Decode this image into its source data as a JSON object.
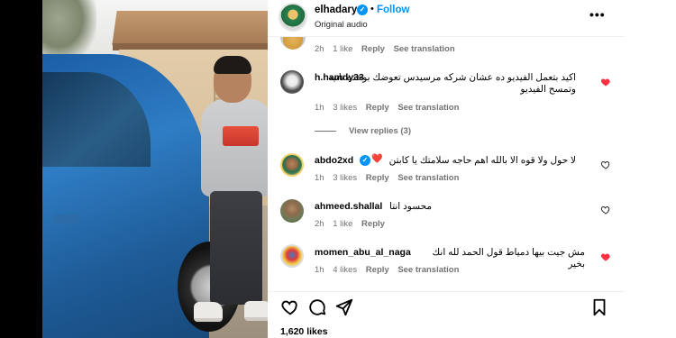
{
  "post": {
    "owner": "elhadary",
    "follow_label": "Follow",
    "separator": "•",
    "audio_label": "Original audio",
    "more_label": "•••",
    "likes_label": "1,620 likes"
  },
  "comments": {
    "first_meta": {
      "time": "2h",
      "likes": "1 like",
      "reply": "Reply",
      "translate": "See translation"
    },
    "items": [
      {
        "username": "h.hamdy33",
        "text": "اكيد بتعمل الفيديو ده عشان شركه مرسيدس تعوضك بوحده تانيه وتمسح الفيديو",
        "time": "1h",
        "likes": "3 likes",
        "reply": "Reply",
        "translate": "See translation",
        "liked": true
      },
      {
        "username": "abdo2xd",
        "text": "لا حول ولا قوه الا بالله اهم حاجه سلامتك يا كابتن",
        "emoji": "❤️",
        "time": "1h",
        "likes": "3 likes",
        "reply": "Reply",
        "translate": "See translation",
        "liked": false
      },
      {
        "username": "ahmeed.shallal",
        "text": "محسود انتا",
        "time": "2h",
        "likes": "1 like",
        "reply": "Reply",
        "liked": false
      },
      {
        "username": "momen_abu_al_naga",
        "text": "مش جيت بيها دمياط قول الحمد لله انك بخير",
        "time": "1h",
        "likes": "4 likes",
        "reply": "Reply",
        "translate": "See translation",
        "liked": true
      }
    ],
    "view_replies": "View replies (3)"
  },
  "colors": {
    "accent": "#0095f6",
    "liked_heart": "#ff3040",
    "muted_text": "#737373"
  },
  "icons": {
    "like": "heart-icon",
    "comment": "comment-icon",
    "share": "send-icon",
    "save": "bookmark-icon",
    "verified": "verified-badge-icon"
  }
}
